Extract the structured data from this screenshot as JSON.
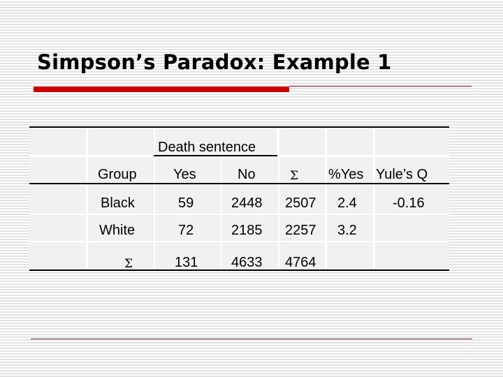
{
  "slide": {
    "title": "Simpson’s Paradox: Example 1",
    "accent_color": "#cc0000"
  },
  "table": {
    "spanning_header": "Death sentence",
    "columns": [
      "Group",
      "Yes",
      "No",
      "Σ",
      "%Yes",
      "Yule’s Q"
    ],
    "rows": [
      {
        "group": "Black",
        "yes": "59",
        "no": "2448",
        "total": "2507",
        "pct_yes": "2.4",
        "yules_q": "-0.16"
      },
      {
        "group": "White",
        "yes": "72",
        "no": "2185",
        "total": "2257",
        "pct_yes": "3.2",
        "yules_q": ""
      },
      {
        "group": "Σ",
        "yes": "131",
        "no": "4633",
        "total": "4764",
        "pct_yes": "",
        "yules_q": ""
      }
    ]
  }
}
